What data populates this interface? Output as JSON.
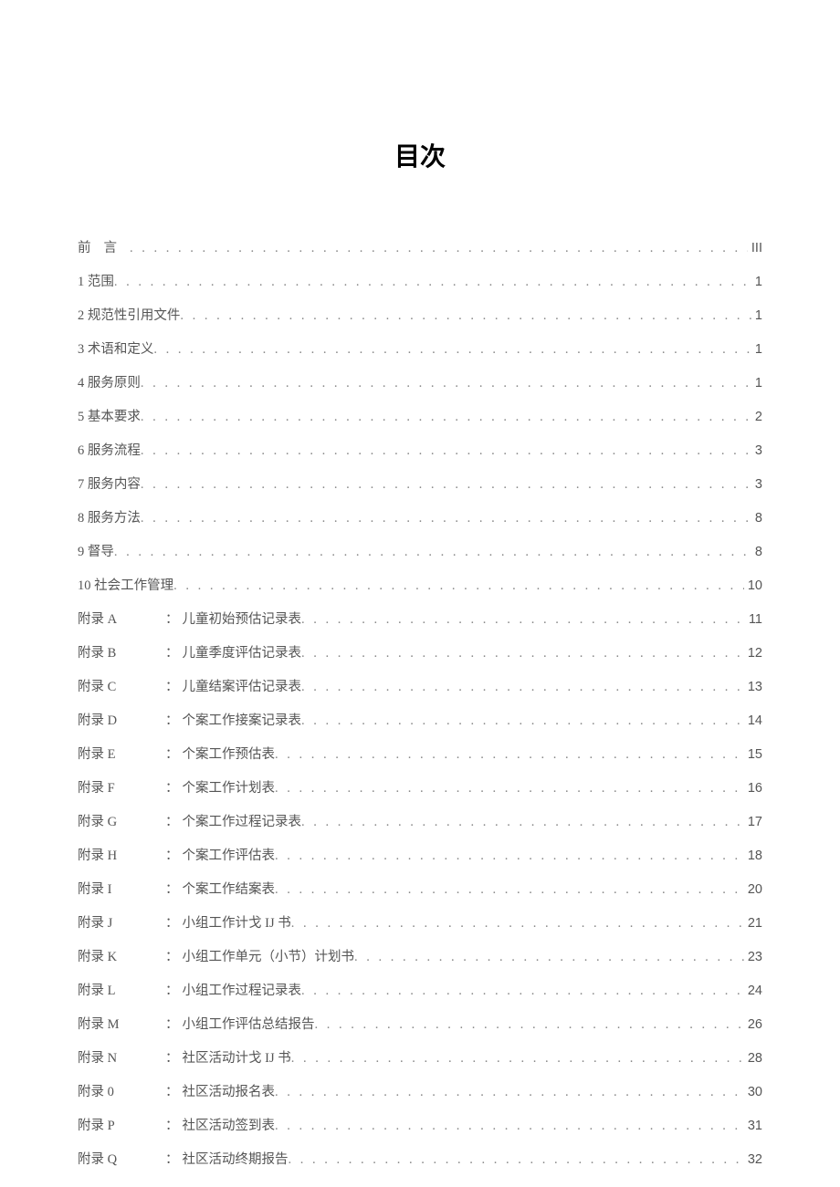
{
  "title": "目次",
  "main_entries": [
    {
      "label": "前言",
      "page": "III",
      "letterspace": true
    },
    {
      "label": "1 范围",
      "page": "1"
    },
    {
      "label": "2 规范性引用文件",
      "page": "1"
    },
    {
      "label": "3 术语和定义",
      "page": "1"
    },
    {
      "label": "4 服务原则",
      "page": "1"
    },
    {
      "label": "5 基本要求",
      "page": "2"
    },
    {
      "label": "6 服务流程",
      "page": "3"
    },
    {
      "label": "7 服务内容",
      "page": "3"
    },
    {
      "label": "8 服务方法",
      "page": "8"
    },
    {
      "label": "9 督导",
      "page": "8"
    },
    {
      "label": "10 社会工作管理",
      "page": "10"
    }
  ],
  "appendix_entries": [
    {
      "prefix": "附录 A",
      "title": "儿童初始预估记录表",
      "page": "11"
    },
    {
      "prefix": "附录 B",
      "title": "儿童季度评估记录表",
      "page": "12"
    },
    {
      "prefix": "附录 C",
      "title": "儿童结案评估记录表",
      "page": "13"
    },
    {
      "prefix": "附录 D",
      "title": "个案工作接案记录表",
      "page": "14"
    },
    {
      "prefix": "附录 E",
      "title": "个案工作预估表",
      "page": "15"
    },
    {
      "prefix": "附录 F",
      "title": "个案工作计划表",
      "page": "16"
    },
    {
      "prefix": "附录 G",
      "title": "个案工作过程记录表",
      "page": "17"
    },
    {
      "prefix": "附录 H",
      "title": "个案工作评估表",
      "page": "18"
    },
    {
      "prefix": "附录 I",
      "title": "个案工作结案表",
      "page": "20"
    },
    {
      "prefix": "附录 J",
      "title": "小组工作计戈 IJ 书",
      "page": "21"
    },
    {
      "prefix": "附录 K",
      "title": "小组工作单元（小节）计划书",
      "page": "23"
    },
    {
      "prefix": "附录 L",
      "title": "小组工作过程记录表",
      "page": "24"
    },
    {
      "prefix": "附录 M",
      "title": "小组工作评估总结报告",
      "page": "26"
    },
    {
      "prefix": "附录 N",
      "title": "社区活动计戈 IJ 书",
      "page": "28"
    },
    {
      "prefix": "附录 0",
      "title": "社区活动报名表",
      "page": "30"
    },
    {
      "prefix": "附录 P",
      "title": "社区活动签到表",
      "page": "31"
    },
    {
      "prefix": "附录 Q",
      "title": "社区活动终期报告",
      "page": "32"
    }
  ]
}
